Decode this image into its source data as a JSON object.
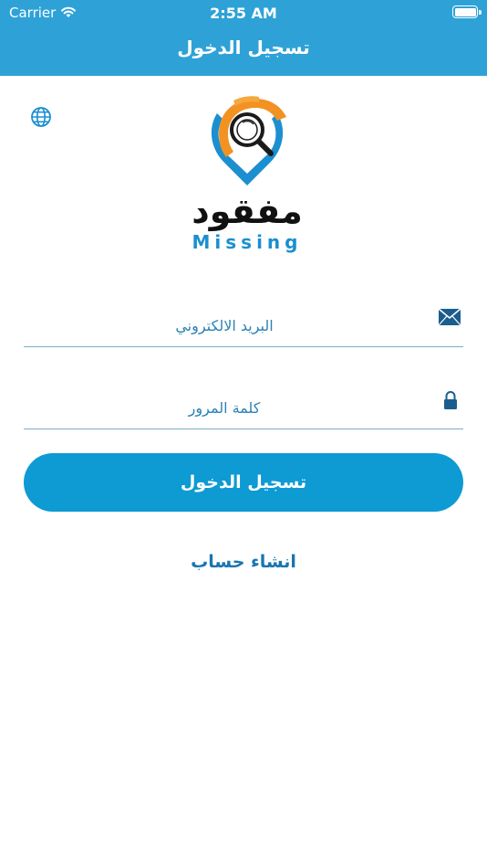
{
  "status_bar": {
    "carrier": "Carrier",
    "time": "2:55 AM"
  },
  "header": {
    "title": "تسجيل الدخول"
  },
  "logo": {
    "arabic_text": "مفقود",
    "english_text": "Missing"
  },
  "icons": {
    "language": "globe-icon",
    "email": "envelope-icon",
    "password": "lock-icon"
  },
  "form": {
    "email_placeholder": "البريد الالكتروني",
    "email_value": "",
    "password_placeholder": "كلمة المرور",
    "password_value": ""
  },
  "actions": {
    "login_label": "تسجيل الدخول",
    "signup_label": "انشاء حساب"
  },
  "colors": {
    "primary": "#2ea2d7",
    "button": "#0e9ad3",
    "accent_orange": "#f29222",
    "link": "#1a75b0"
  }
}
